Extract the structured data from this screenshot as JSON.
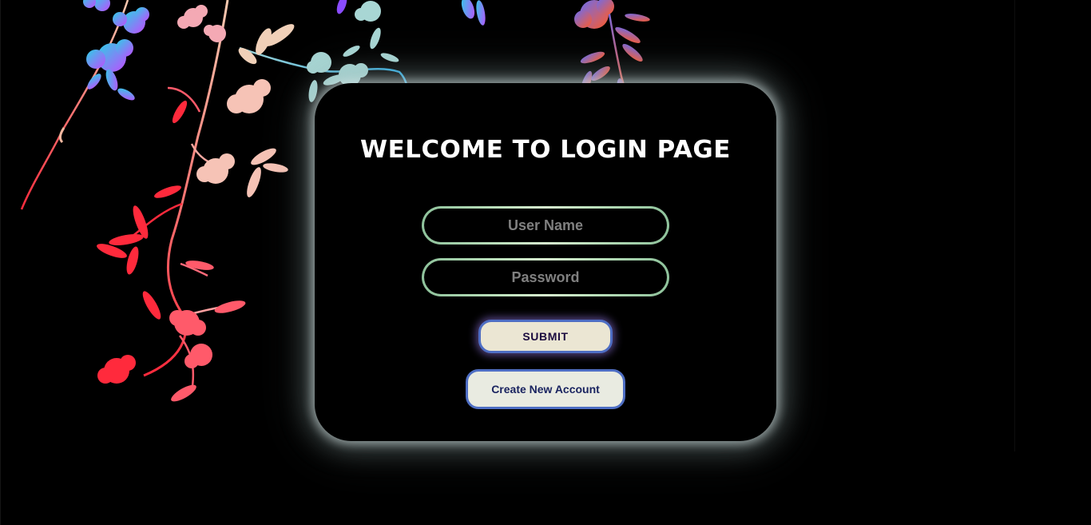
{
  "page": {
    "title": "WELCOME TO LOGIN PAGE"
  },
  "form": {
    "username": {
      "placeholder": "User Name",
      "value": ""
    },
    "password": {
      "placeholder": "Password",
      "value": ""
    },
    "submit_label": "SUBMIT",
    "create_account_label": "Create New Account"
  },
  "colors": {
    "background": "#000000",
    "card_glow": "#dcebeb",
    "field_border": "#a9d8b0",
    "button_border": "#4e6ec4",
    "submit_bg": "#ebe6d3",
    "create_bg": "#e9ebe1"
  },
  "decor": {
    "icon": "floral-vine-illustration"
  }
}
